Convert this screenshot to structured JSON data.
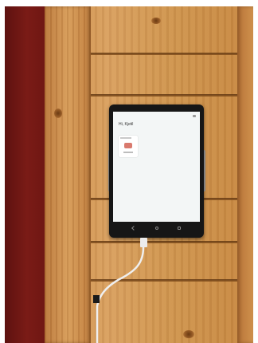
{
  "scene": {
    "description_tag": "wall-mounted-tablet"
  },
  "tablet": {
    "screen": {
      "title": "Hi, Kjetil",
      "subtitle": "",
      "card_icon": "device-icon"
    },
    "nav_icons": [
      "back-icon",
      "home-icon",
      "recent-apps-icon"
    ]
  },
  "colors": {
    "wall_red": "#7a1b16",
    "wood": "#d9a060",
    "tablet_bezel": "#161616",
    "screen_bg": "#f3f6f6"
  }
}
